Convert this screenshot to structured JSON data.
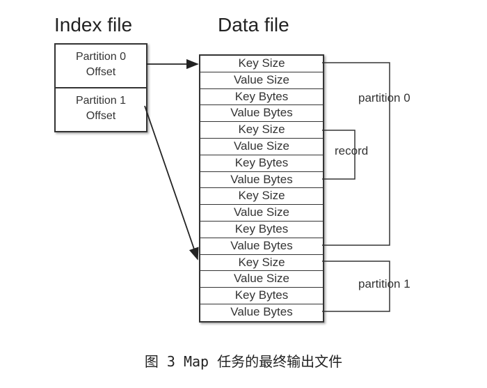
{
  "titles": {
    "index_file": "Index file",
    "data_file": "Data file"
  },
  "index_entries": [
    {
      "line1": "Partition 0",
      "line2": "Offset"
    },
    {
      "line1": "Partition 1",
      "line2": "Offset"
    }
  ],
  "data_rows": [
    "Key Size",
    "Value Size",
    "Key Bytes",
    "Value Bytes",
    "Key Size",
    "Value Size",
    "Key Bytes",
    "Value Bytes",
    "Key Size",
    "Value Size",
    "Key Bytes",
    "Value Bytes",
    "Key Size",
    "Value Size",
    "Key Bytes",
    "Value Bytes"
  ],
  "brackets": {
    "partition0": "partition 0",
    "record": "record",
    "partition1": "partition 1"
  },
  "caption": "图 3 Map 任务的最终输出文件"
}
